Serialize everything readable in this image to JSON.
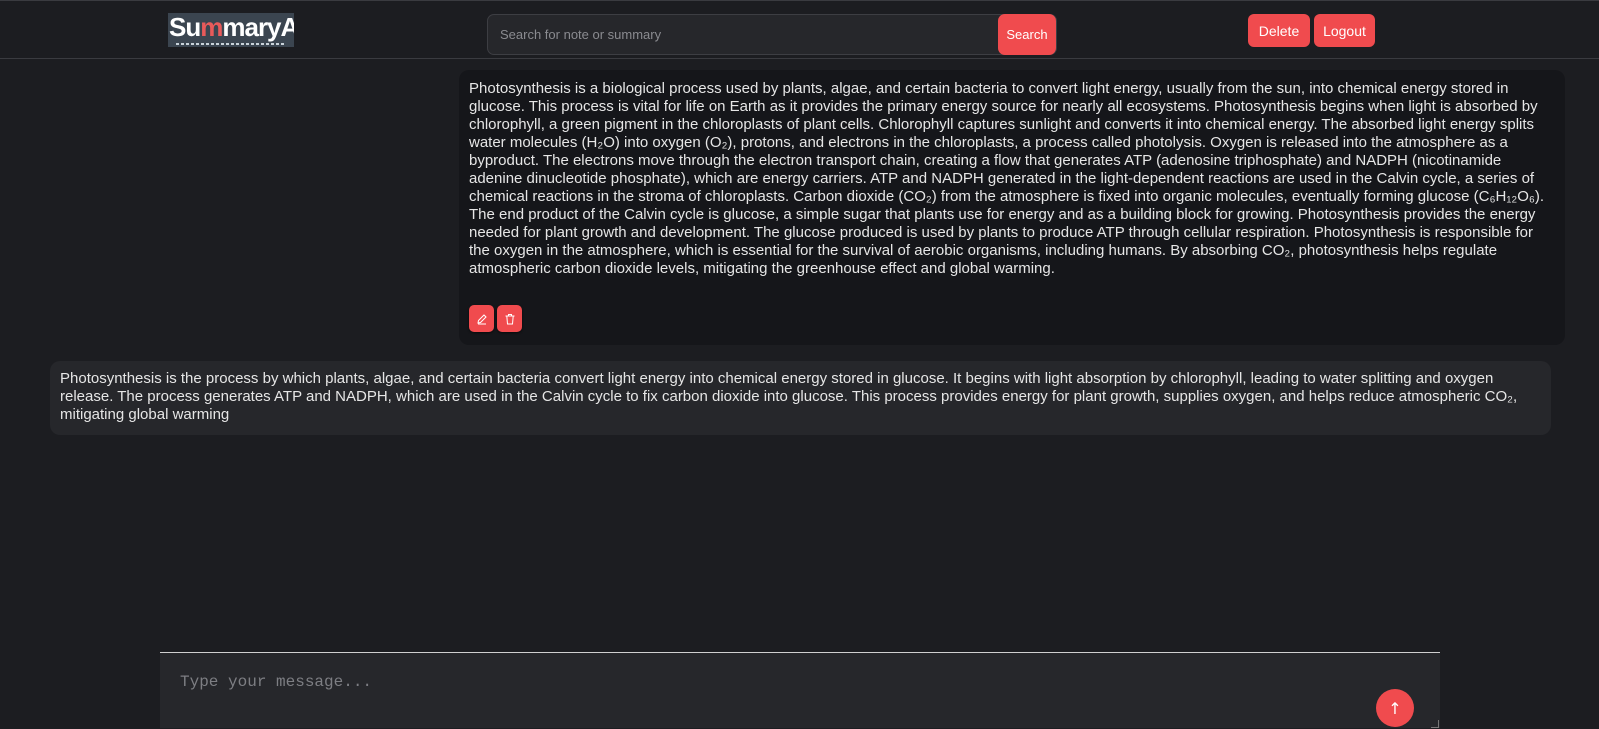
{
  "header": {
    "logo": {
      "part1": "Su",
      "accent": "m",
      "part2": "maryAi"
    },
    "search": {
      "placeholder": "Search for note or summary",
      "value": "",
      "button_label": "Search"
    },
    "delete_label": "Delete",
    "logout_label": "Logout"
  },
  "messages": [
    {
      "role": "user",
      "text": "Photosynthesis is a biological process used by plants, algae, and certain bacteria to convert light energy, usually from the sun, into chemical energy stored in glucose. This process is vital for life on Earth as it provides the primary energy source for nearly all ecosystems. Photosynthesis begins when light is absorbed by chlorophyll, a green pigment in the chloroplasts of plant cells. Chlorophyll captures sunlight and converts it into chemical energy. The absorbed light energy splits water molecules (H₂O) into oxygen (O₂), protons, and electrons in the chloroplasts, a process called photolysis. Oxygen is released into the atmosphere as a byproduct. The electrons move through the electron transport chain, creating a flow that generates ATP (adenosine triphosphate) and NADPH (nicotinamide adenine dinucleotide phosphate), which are energy carriers. ATP and NADPH generated in the light-dependent reactions are used in the Calvin cycle, a series of chemical reactions in the stroma of chloroplasts. Carbon dioxide (CO₂) from the atmosphere is fixed into organic molecules, eventually forming glucose (C₆H₁₂O₆). The end product of the Calvin cycle is glucose, a simple sugar that plants use for energy and as a building block for growing. Photosynthesis provides the energy needed for plant growth and development. The glucose produced is used by plants to produce ATP through cellular respiration. Photosynthesis is responsible for the oxygen in the atmosphere, which is essential for the survival of aerobic organisms, including humans. By absorbing CO₂, photosynthesis helps regulate atmospheric carbon dioxide levels, mitigating the greenhouse effect and global warming.",
      "actions": [
        {
          "icon": "edit-icon"
        },
        {
          "icon": "trash-icon"
        }
      ]
    },
    {
      "role": "summary",
      "text": "Photosynthesis is the process by which plants, algae, and certain bacteria convert light energy into chemical energy stored in glucose. It begins with light absorption by chlorophyll, leading to water splitting and oxygen release. The process generates ATP and NADPH, which are used in the Calvin cycle to fix carbon dioxide into glucose. This process provides energy for plant growth, supplies oxygen, and helps reduce atmospheric CO₂, mitigating global warming"
    }
  ],
  "composer": {
    "placeholder": "Type your message...",
    "value": "",
    "send_label": "↑"
  },
  "colors": {
    "accent": "#f04b4e",
    "background": "#1c1d21",
    "user_bubble": "#15161a",
    "summary_bubble": "#26272b"
  }
}
